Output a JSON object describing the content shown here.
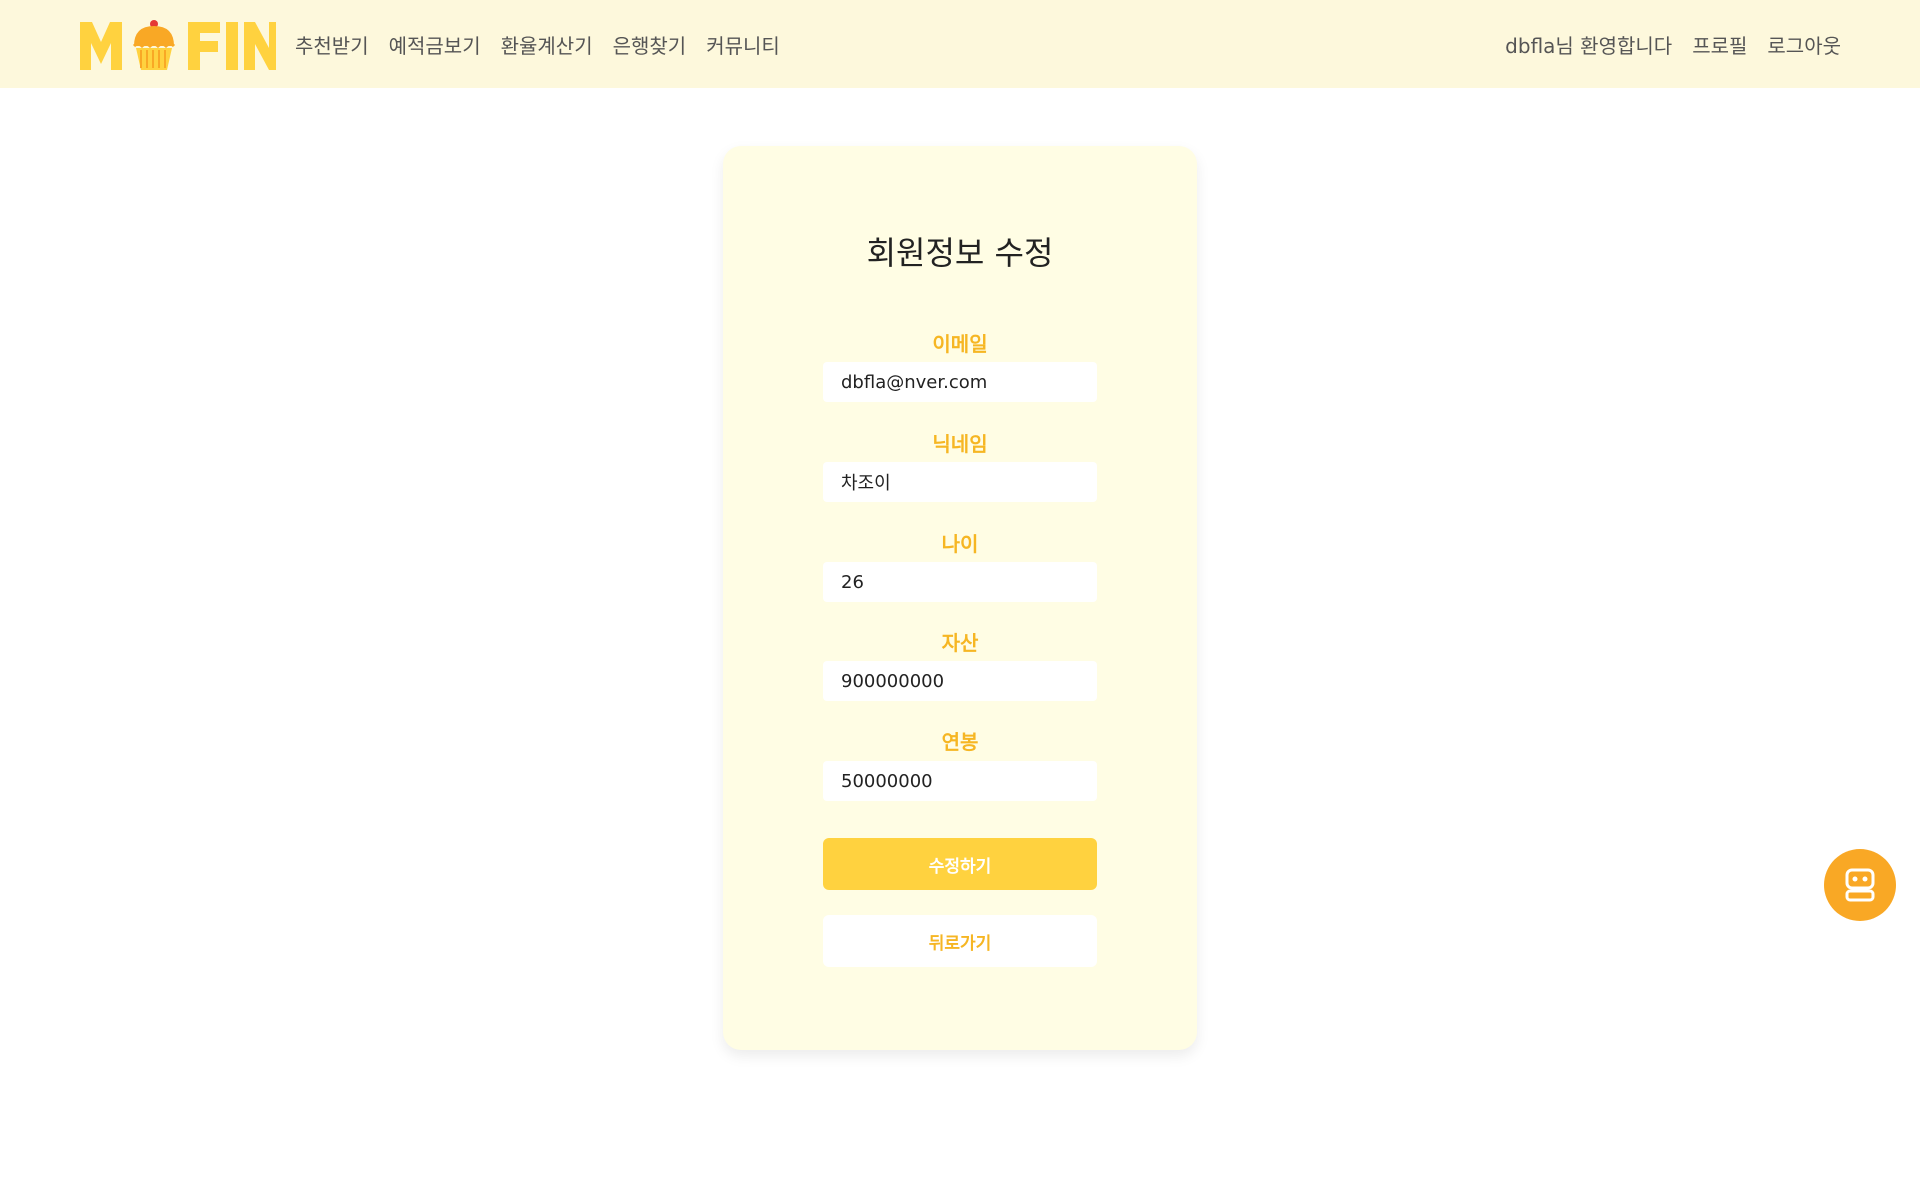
{
  "brand": {
    "logo_text": "MFIN",
    "colors": {
      "primary": "#ffd23f",
      "accent": "#f6b623",
      "nav_bg": "#fdf8dc",
      "card_bg": "#fffde4",
      "chatbot": "#f9a825"
    }
  },
  "nav": {
    "links": [
      "추천받기",
      "예적금보기",
      "환율계산기",
      "은행찾기",
      "커뮤니티"
    ],
    "welcome": "dbfla님 환영합니다",
    "profile": "프로필",
    "logout": "로그아웃"
  },
  "form": {
    "title": "회원정보 수정",
    "fields": [
      {
        "label": "이메일",
        "value": "dbfla@nver.com"
      },
      {
        "label": "닉네임",
        "value": "차조이"
      },
      {
        "label": "나이",
        "value": "26"
      },
      {
        "label": "자산",
        "value": "900000000"
      },
      {
        "label": "연봉",
        "value": "50000000"
      }
    ],
    "submit_label": "수정하기",
    "back_label": "뒤로가기"
  },
  "chatbot": {
    "icon": "robot-icon"
  }
}
